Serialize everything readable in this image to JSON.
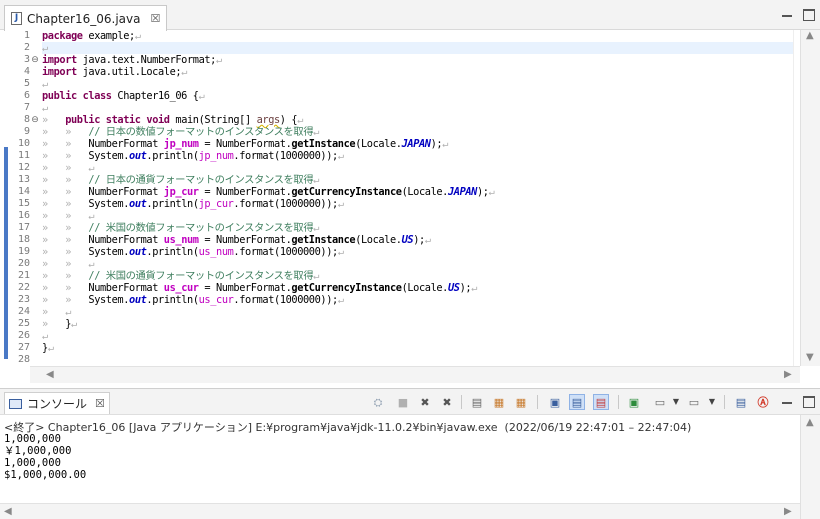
{
  "editor": {
    "tab_title": "Chapter16_06.java",
    "tab_close_glyph": "☒",
    "file_icon_letter": "J"
  },
  "code_lines": [
    [
      {
        "t": "package",
        "c": "kw"
      },
      {
        "t": " example;",
        "c": ""
      },
      {
        "t": "↵",
        "c": "ws"
      }
    ],
    [
      {
        "t": "↵",
        "c": "ws"
      }
    ],
    [
      {
        "t": "import",
        "c": "kw"
      },
      {
        "t": " java.text.NumberFormat;",
        "c": ""
      },
      {
        "t": "↵",
        "c": "ws"
      }
    ],
    [
      {
        "t": "import",
        "c": "kw"
      },
      {
        "t": " java.util.Locale;",
        "c": ""
      },
      {
        "t": "↵",
        "c": "ws"
      }
    ],
    [
      {
        "t": "↵",
        "c": "ws"
      }
    ],
    [
      {
        "t": "public class",
        "c": "kw"
      },
      {
        "t": " Chapter16_06 {",
        "c": ""
      },
      {
        "t": "↵",
        "c": "ws"
      }
    ],
    [
      {
        "t": "↵",
        "c": "ws"
      }
    ],
    [
      {
        "t": "»   ",
        "c": "ws"
      },
      {
        "t": "public static void",
        "c": "kw"
      },
      {
        "t": " main(String[] ",
        "c": ""
      },
      {
        "t": "args",
        "c": "uarg"
      },
      {
        "t": ") {",
        "c": ""
      },
      {
        "t": "↵",
        "c": "ws"
      }
    ],
    [
      {
        "t": "»   »   ",
        "c": "ws"
      },
      {
        "t": "// 日本の数値フォーマットのインスタンスを取得",
        "c": "cm"
      },
      {
        "t": "↵",
        "c": "ws"
      }
    ],
    [
      {
        "t": "»   »   ",
        "c": "ws"
      },
      {
        "t": "NumberFormat ",
        "c": ""
      },
      {
        "t": "jp_num",
        "c": "vard"
      },
      {
        "t": " = NumberFormat.",
        "c": ""
      },
      {
        "t": "getInstance",
        "c": "mth"
      },
      {
        "t": "(Locale.",
        "c": ""
      },
      {
        "t": "JAPAN",
        "c": "fl"
      },
      {
        "t": ");",
        "c": ""
      },
      {
        "t": "↵",
        "c": "ws"
      }
    ],
    [
      {
        "t": "»   »   ",
        "c": "ws"
      },
      {
        "t": "System.",
        "c": ""
      },
      {
        "t": "out",
        "c": "fl"
      },
      {
        "t": ".println(",
        "c": ""
      },
      {
        "t": "jp_num",
        "c": "varu"
      },
      {
        "t": ".format(1000000));",
        "c": ""
      },
      {
        "t": "↵",
        "c": "ws"
      }
    ],
    [
      {
        "t": "»   »   ",
        "c": "ws"
      },
      {
        "t": "↵",
        "c": "ws"
      }
    ],
    [
      {
        "t": "»   »   ",
        "c": "ws"
      },
      {
        "t": "// 日本の通貨フォーマットのインスタンスを取得",
        "c": "cm"
      },
      {
        "t": "↵",
        "c": "ws"
      }
    ],
    [
      {
        "t": "»   »   ",
        "c": "ws"
      },
      {
        "t": "NumberFormat ",
        "c": ""
      },
      {
        "t": "jp_cur",
        "c": "vard"
      },
      {
        "t": " = NumberFormat.",
        "c": ""
      },
      {
        "t": "getCurrencyInstance",
        "c": "mth"
      },
      {
        "t": "(Locale.",
        "c": ""
      },
      {
        "t": "JAPAN",
        "c": "fl"
      },
      {
        "t": ");",
        "c": ""
      },
      {
        "t": "↵",
        "c": "ws"
      }
    ],
    [
      {
        "t": "»   »   ",
        "c": "ws"
      },
      {
        "t": "System.",
        "c": ""
      },
      {
        "t": "out",
        "c": "fl"
      },
      {
        "t": ".println(",
        "c": ""
      },
      {
        "t": "jp_cur",
        "c": "varu"
      },
      {
        "t": ".format(1000000));",
        "c": ""
      },
      {
        "t": "↵",
        "c": "ws"
      }
    ],
    [
      {
        "t": "»   »   ",
        "c": "ws"
      },
      {
        "t": "↵",
        "c": "ws"
      }
    ],
    [
      {
        "t": "»   »   ",
        "c": "ws"
      },
      {
        "t": "// 米国の数値フォーマットのインスタンスを取得",
        "c": "cm"
      },
      {
        "t": "↵",
        "c": "ws"
      }
    ],
    [
      {
        "t": "»   »   ",
        "c": "ws"
      },
      {
        "t": "NumberFormat ",
        "c": ""
      },
      {
        "t": "us_num",
        "c": "vard"
      },
      {
        "t": " = NumberFormat.",
        "c": ""
      },
      {
        "t": "getInstance",
        "c": "mth"
      },
      {
        "t": "(Locale.",
        "c": ""
      },
      {
        "t": "US",
        "c": "fl"
      },
      {
        "t": ");",
        "c": ""
      },
      {
        "t": "↵",
        "c": "ws"
      }
    ],
    [
      {
        "t": "»   »   ",
        "c": "ws"
      },
      {
        "t": "System.",
        "c": ""
      },
      {
        "t": "out",
        "c": "fl"
      },
      {
        "t": ".println(",
        "c": ""
      },
      {
        "t": "us_num",
        "c": "varu"
      },
      {
        "t": ".format(1000000));",
        "c": ""
      },
      {
        "t": "↵",
        "c": "ws"
      }
    ],
    [
      {
        "t": "»   »   ",
        "c": "ws"
      },
      {
        "t": "↵",
        "c": "ws"
      }
    ],
    [
      {
        "t": "»   »   ",
        "c": "ws"
      },
      {
        "t": "// 米国の通貨フォーマットのインスタンスを取得",
        "c": "cm"
      },
      {
        "t": "↵",
        "c": "ws"
      }
    ],
    [
      {
        "t": "»   »   ",
        "c": "ws"
      },
      {
        "t": "NumberFormat ",
        "c": ""
      },
      {
        "t": "us_cur",
        "c": "vard"
      },
      {
        "t": " = NumberFormat.",
        "c": ""
      },
      {
        "t": "getCurrencyInstance",
        "c": "mth"
      },
      {
        "t": "(Locale.",
        "c": ""
      },
      {
        "t": "US",
        "c": "fl"
      },
      {
        "t": ");",
        "c": ""
      },
      {
        "t": "↵",
        "c": "ws"
      }
    ],
    [
      {
        "t": "»   »   ",
        "c": "ws"
      },
      {
        "t": "System.",
        "c": ""
      },
      {
        "t": "out",
        "c": "fl"
      },
      {
        "t": ".println(",
        "c": ""
      },
      {
        "t": "us_cur",
        "c": "varu"
      },
      {
        "t": ".format(1000000));",
        "c": ""
      },
      {
        "t": "↵",
        "c": "ws"
      }
    ],
    [
      {
        "t": "»   ",
        "c": "ws"
      },
      {
        "t": "↵",
        "c": "ws"
      }
    ],
    [
      {
        "t": "»   ",
        "c": "ws"
      },
      {
        "t": "}",
        "c": ""
      },
      {
        "t": "↵",
        "c": "ws"
      }
    ],
    [
      {
        "t": "↵",
        "c": "ws"
      }
    ],
    [
      {
        "t": "}",
        "c": ""
      },
      {
        "t": "↵",
        "c": "ws"
      }
    ],
    []
  ],
  "line_numbers": [
    "1",
    "2",
    "3",
    "4",
    "5",
    "6",
    "7",
    "8",
    "9",
    "10",
    "11",
    "12",
    "13",
    "14",
    "15",
    "16",
    "17",
    "18",
    "19",
    "20",
    "21",
    "22",
    "23",
    "24",
    "25",
    "26",
    "27",
    "28"
  ],
  "fold_markers": {
    "3": "⊖",
    "8": "⊖"
  },
  "current_line": 2,
  "console": {
    "tab_title": "コンソール",
    "tab_close_glyph": "☒",
    "status": "<終了> Chapter16_06 [Java アプリケーション] E:¥program¥java¥jdk-11.0.2¥bin¥javaw.exe  (2022/06/19 22:47:01 – 22:47:04)",
    "output": [
      "1,000,000",
      "￥1,000,000",
      "1,000,000",
      "$1,000,000.00"
    ]
  },
  "colors": {
    "keyword": "#7f0055",
    "comment": "#3f7f5f",
    "static_field": "#0000c0",
    "local_var": "#c000c0",
    "ruler": "#4a79c6",
    "current_line": "#e8f2fe"
  },
  "console_toolbar_icons": [
    "pin-icon",
    "terminate-icon",
    "remove-launch-icon",
    "remove-all-icon",
    "scroll-lock-icon",
    "word-wrap-icon",
    "show-console-icon",
    "display-selected-icon",
    "open-console-icon",
    "new-console-icon",
    "copy-icon",
    "error-icon",
    "minimize-icon",
    "maximize-icon"
  ]
}
